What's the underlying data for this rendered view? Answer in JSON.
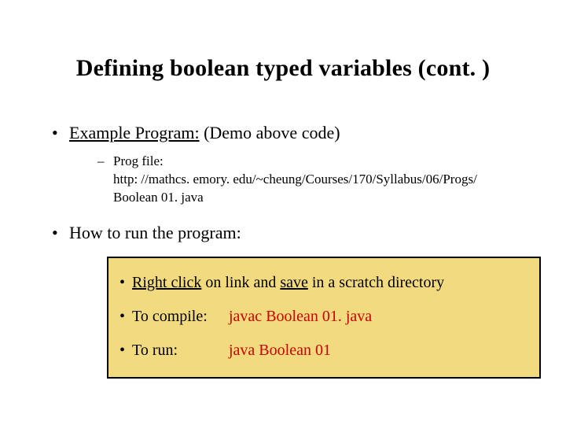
{
  "title": "Defining boolean typed variables (cont. )",
  "bullet1": {
    "label_u": "Example Program:",
    "rest": " (Demo above code)"
  },
  "sub1": {
    "label": "Prog file:",
    "url": "http: //mathcs. emory. edu/~cheung/Courses/170/Syllabus/06/Progs/ Boolean 01. java"
  },
  "bullet2": "How to run the program:",
  "box": {
    "row1": {
      "pre": "",
      "u1": "Right click",
      "mid": " on link and ",
      "u2": "save",
      "post": " in a scratch directory"
    },
    "row2": {
      "label": "To compile:",
      "cmd": "javac Boolean 01. java"
    },
    "row3": {
      "label": "To run:",
      "cmd": "java Boolean 01"
    }
  }
}
